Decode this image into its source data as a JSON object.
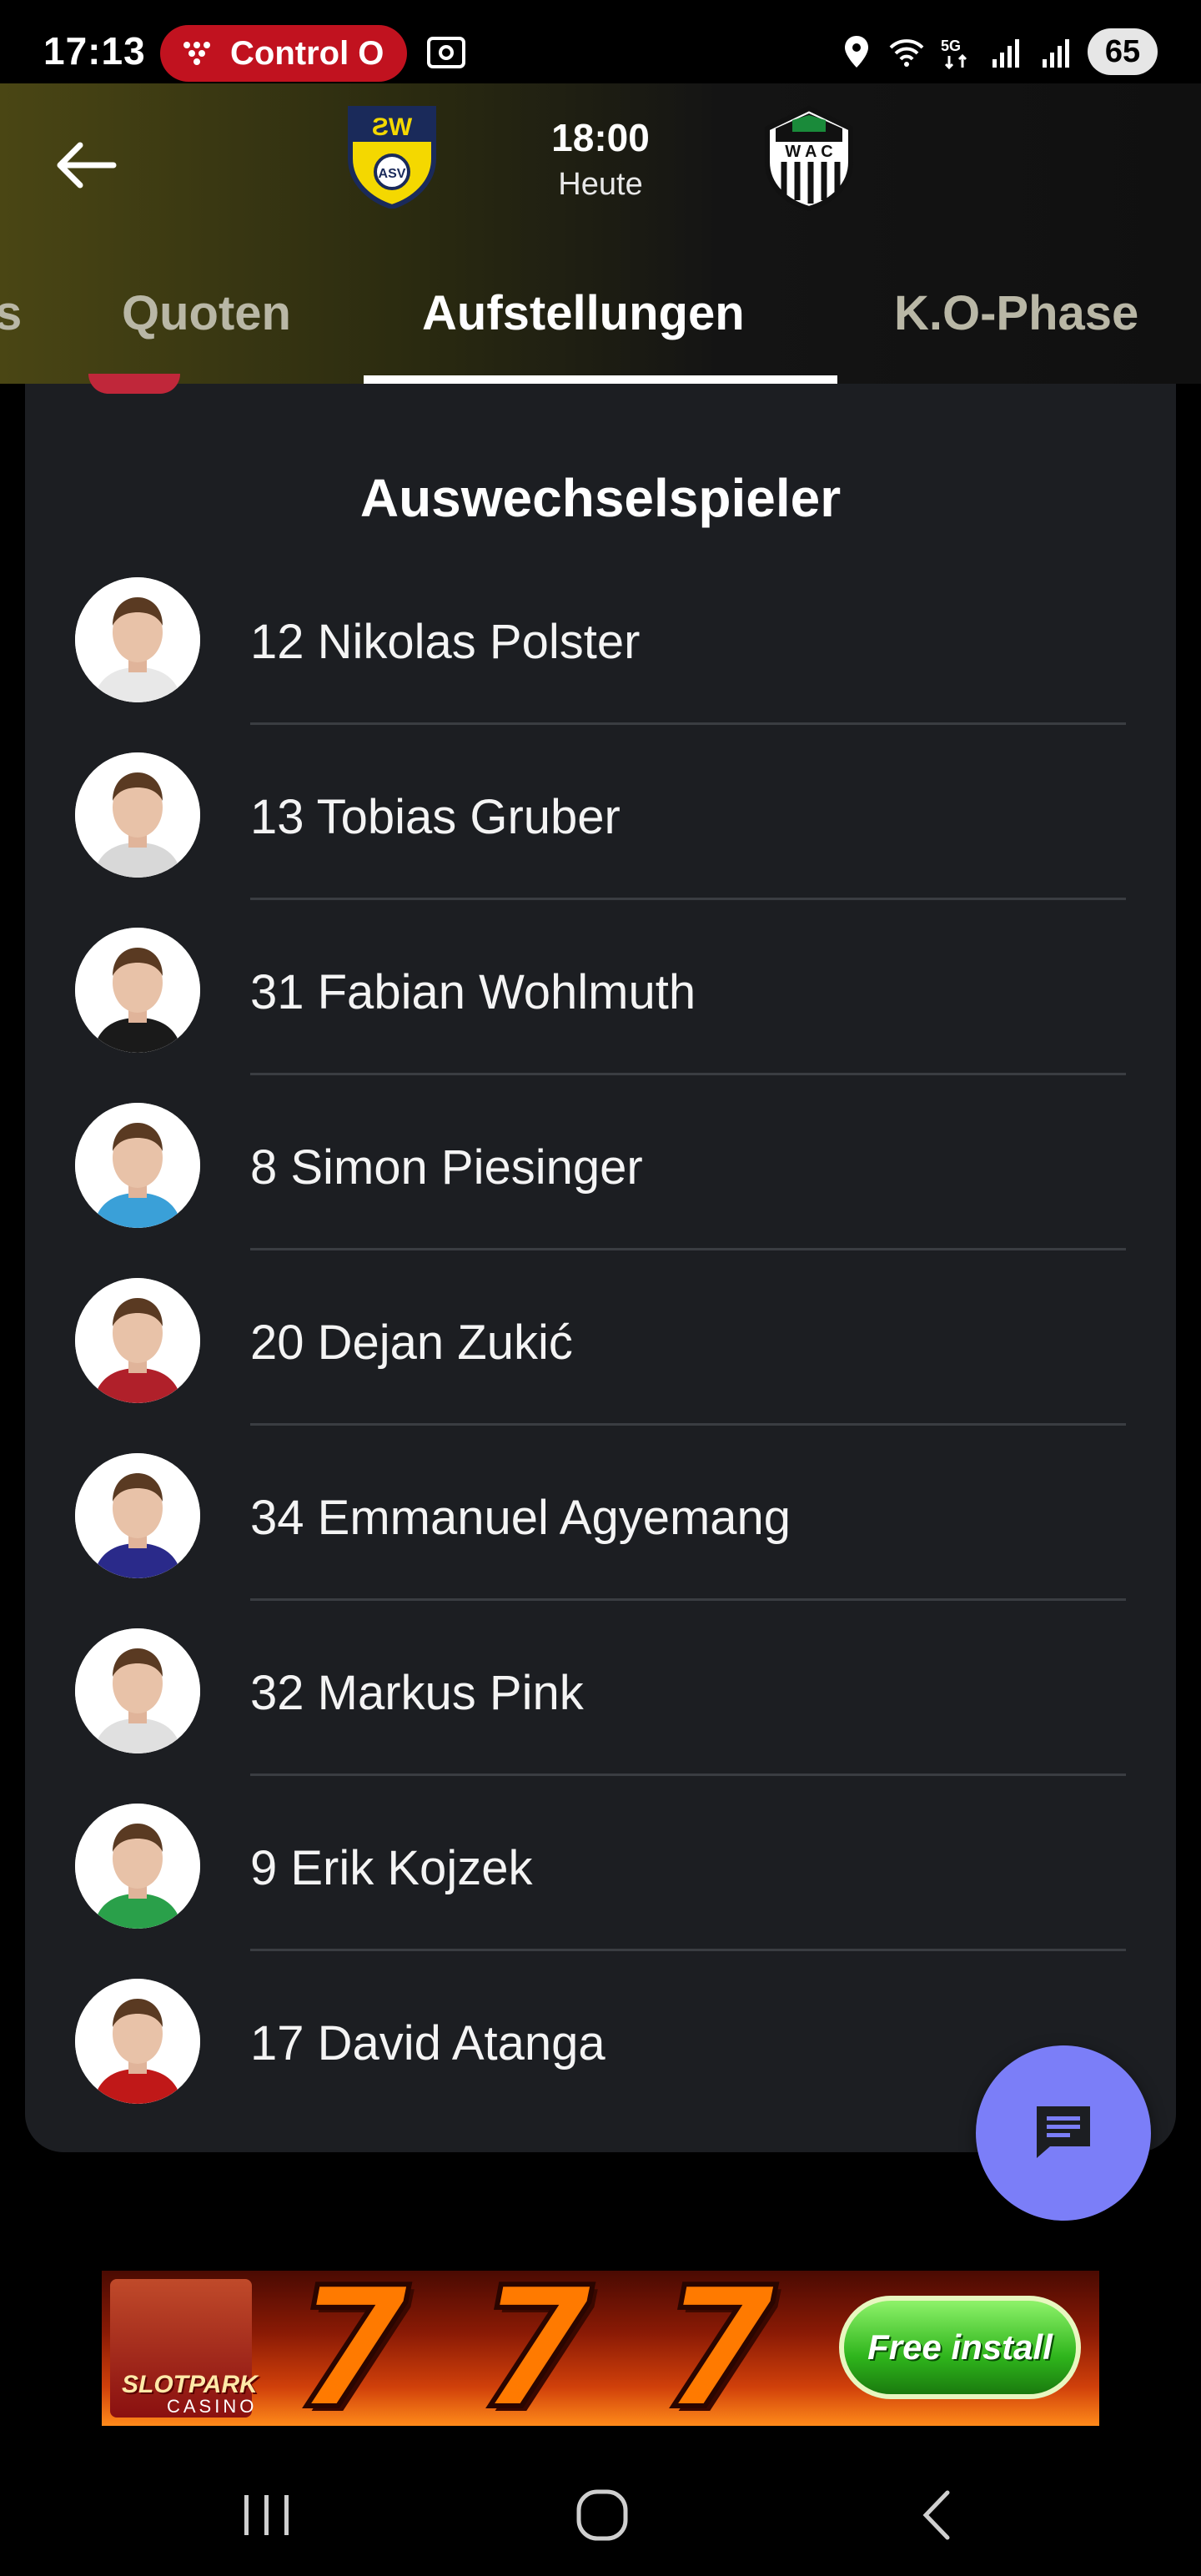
{
  "status_bar": {
    "time": "17:13",
    "notification_pill": "Control O",
    "signal_5g": "5G",
    "wifi_badge": "5",
    "battery": "65"
  },
  "header": {
    "kickoff_time": "18:00",
    "kickoff_day": "Heute",
    "home_logo_text": "ASV",
    "away_logo_text": "W A C"
  },
  "tabs": [
    {
      "label": "s"
    },
    {
      "label": "Quoten"
    },
    {
      "label": "Aufstellungen",
      "active": true
    },
    {
      "label": "K.O-Phase"
    }
  ],
  "section": {
    "title": "Auswechselspieler"
  },
  "players": [
    {
      "label": "12 Nikolas Polster",
      "shirt": "#e8e8e8"
    },
    {
      "label": "13 Tobias Gruber",
      "shirt": "#d8d8d8"
    },
    {
      "label": "31 Fabian Wohlmuth",
      "shirt": "#1a1a1a"
    },
    {
      "label": "8 Simon Piesinger",
      "shirt": "#3aa0d8"
    },
    {
      "label": "20 Dejan Zukić",
      "shirt": "#b0202a"
    },
    {
      "label": "34 Emmanuel Agyemang",
      "shirt": "#2a2a8a"
    },
    {
      "label": "32 Markus Pink",
      "shirt": "#e0e0e0"
    },
    {
      "label": "9 Erik Kojzek",
      "shirt": "#2aa04a"
    },
    {
      "label": "17 David Atanga",
      "shirt": "#c01818"
    }
  ],
  "ad": {
    "brand": "SLOTPARK",
    "brand_sub": "CASINO",
    "symbols": [
      "7",
      "7",
      "7"
    ],
    "cta": "Free install"
  },
  "colors": {
    "card_bg": "#1c1e22",
    "fab": "#7b7ef8",
    "status_pill": "#c1121f"
  }
}
